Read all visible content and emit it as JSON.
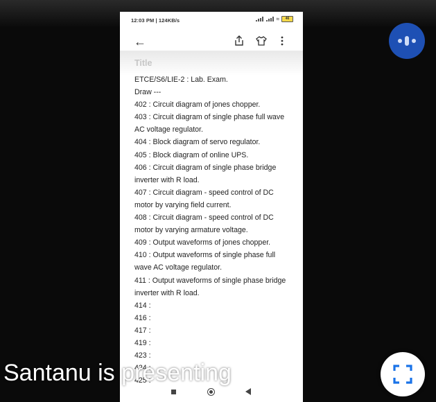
{
  "status_bar": {
    "time_speed": "12:03 PM | 124KB/s",
    "battery": "46"
  },
  "note": {
    "title_placeholder": "Title",
    "lines": [
      "ETCE/S6/LIE-2 : Lab. Exam.",
      "Draw ---",
      "402 : Circuit diagram of jones chopper.",
      "403 : Circuit diagram of single phase full wave AC voltage regulator.",
      "404 : Block diagram of servo regulator.",
      "405 : Block diagram of online UPS.",
      "406 : Circuit diagram of single phase bridge inverter with R load.",
      "407 : Circuit diagram - speed control of DC motor by varying field current.",
      "408 : Circuit diagram - speed control of DC motor by varying armature voltage.",
      "409 : Output waveforms of jones chopper.",
      "410 : Output waveforms of single phase full wave AC voltage regulator.",
      "411 : Output waveforms of single phase bridge inverter with R load.",
      "414 :",
      "416 :",
      "417 :",
      "419 :",
      "423 :",
      "424 :",
      "425 :"
    ]
  },
  "overlay": {
    "presenting_text": "Santanu is presenting"
  },
  "icons": {
    "back": "back-arrow-icon",
    "share": "share-icon",
    "theme": "shirt-icon",
    "more": "more-vert-icon",
    "speaker": "speaking-indicator-icon",
    "fullscreen": "fullscreen-icon"
  },
  "colors": {
    "speaker_button": "#1e50b4",
    "background": "#0a0a0a"
  }
}
